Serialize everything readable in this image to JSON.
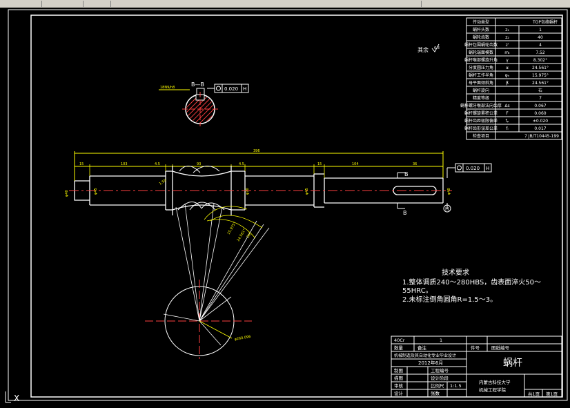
{
  "title_block": {
    "drawing_name": "蜗杆",
    "material": "40Cr",
    "quantity": "1",
    "col_headers": [
      "数量",
      "备注",
      "件号",
      "图纸编号"
    ],
    "project": "机械制造及其自动化专业毕业设计",
    "date": "2012年6月",
    "roles": [
      "制图",
      "描图",
      "审核",
      "设计"
    ],
    "cells": [
      "工程编号",
      "设计阶段",
      "比例尺",
      "张数"
    ],
    "scale": "1:1.5",
    "school": "内蒙古科技大学",
    "department": "机械工程学院",
    "sheet_total": "共1页",
    "sheet_no": "第1页"
  },
  "param_table": [
    {
      "name": "传动类型",
      "sym": "",
      "value": "TOP包络蜗杆"
    },
    {
      "name": "蜗杆头数",
      "sym": "z₁",
      "value": "1"
    },
    {
      "name": "蜗轮齿数",
      "sym": "z₂",
      "value": "40"
    },
    {
      "name": "蜗杆包围蜗轮齿数",
      "sym": "z'",
      "value": "4"
    },
    {
      "name": "蜗轮端面模数",
      "sym": "mₜ",
      "value": "7.52"
    },
    {
      "name": "蜗杆喉部螺旋升角",
      "sym": "γ",
      "value": "8.302°"
    },
    {
      "name": "分度圆压力角",
      "sym": "α",
      "value": "24.561°"
    },
    {
      "name": "蜗杆工作半角",
      "sym": "φₕ",
      "value": "15.975°"
    },
    {
      "name": "母平面倾斜角",
      "sym": "β",
      "value": "24.561°"
    },
    {
      "name": "蜗杆旋向",
      "sym": "",
      "value": "右"
    },
    {
      "name": "精度等级",
      "sym": "",
      "value": "7"
    },
    {
      "name": "蜗杆螺牙喉部法向齿厚",
      "sym": "Δs",
      "value": "0.067"
    },
    {
      "name": "蜗杆螺旋累积公差",
      "sym": "F",
      "value": "0.060"
    },
    {
      "name": "蜗杆齿距极限偏差",
      "sym": "fₚ",
      "value": "±0.020"
    },
    {
      "name": "蜗杆齿形误差公差",
      "sym": "fᵢ",
      "value": "0.017"
    },
    {
      "name": "检查项目",
      "sym": "",
      "value": "7 JB/T10445-199"
    }
  ],
  "roughness_note": "其余",
  "section_label": "B—B",
  "tolerance": {
    "symbol": "⊙",
    "value": "0.020",
    "datum": "H"
  },
  "tech_req": {
    "title": "技术要求",
    "lines": [
      "1.整体调质240～280HBS，齿表面淬火50～",
      "55HRC。",
      "2.未标注倒角圆角R=1.5～3。"
    ]
  },
  "dims": {
    "overall": "396",
    "left_1": "15",
    "left_2": "103",
    "left_3": "4.5",
    "middle": "93",
    "right_1": "4.5",
    "right_2": "15",
    "right_3": "104",
    "right_4": "36",
    "dia_left": "φ40",
    "dia_2": "φ45",
    "dia_throat": "φ70",
    "dia_3": "φ45",
    "dia_right": "φ40",
    "keyway": "18",
    "radius_circle": "φ260.096"
  },
  "labels": {
    "section_B": "B",
    "datum_H": "H",
    "angles": [
      "15.975°",
      "24.561°",
      "26°"
    ],
    "keyway_small": "1:50"
  }
}
